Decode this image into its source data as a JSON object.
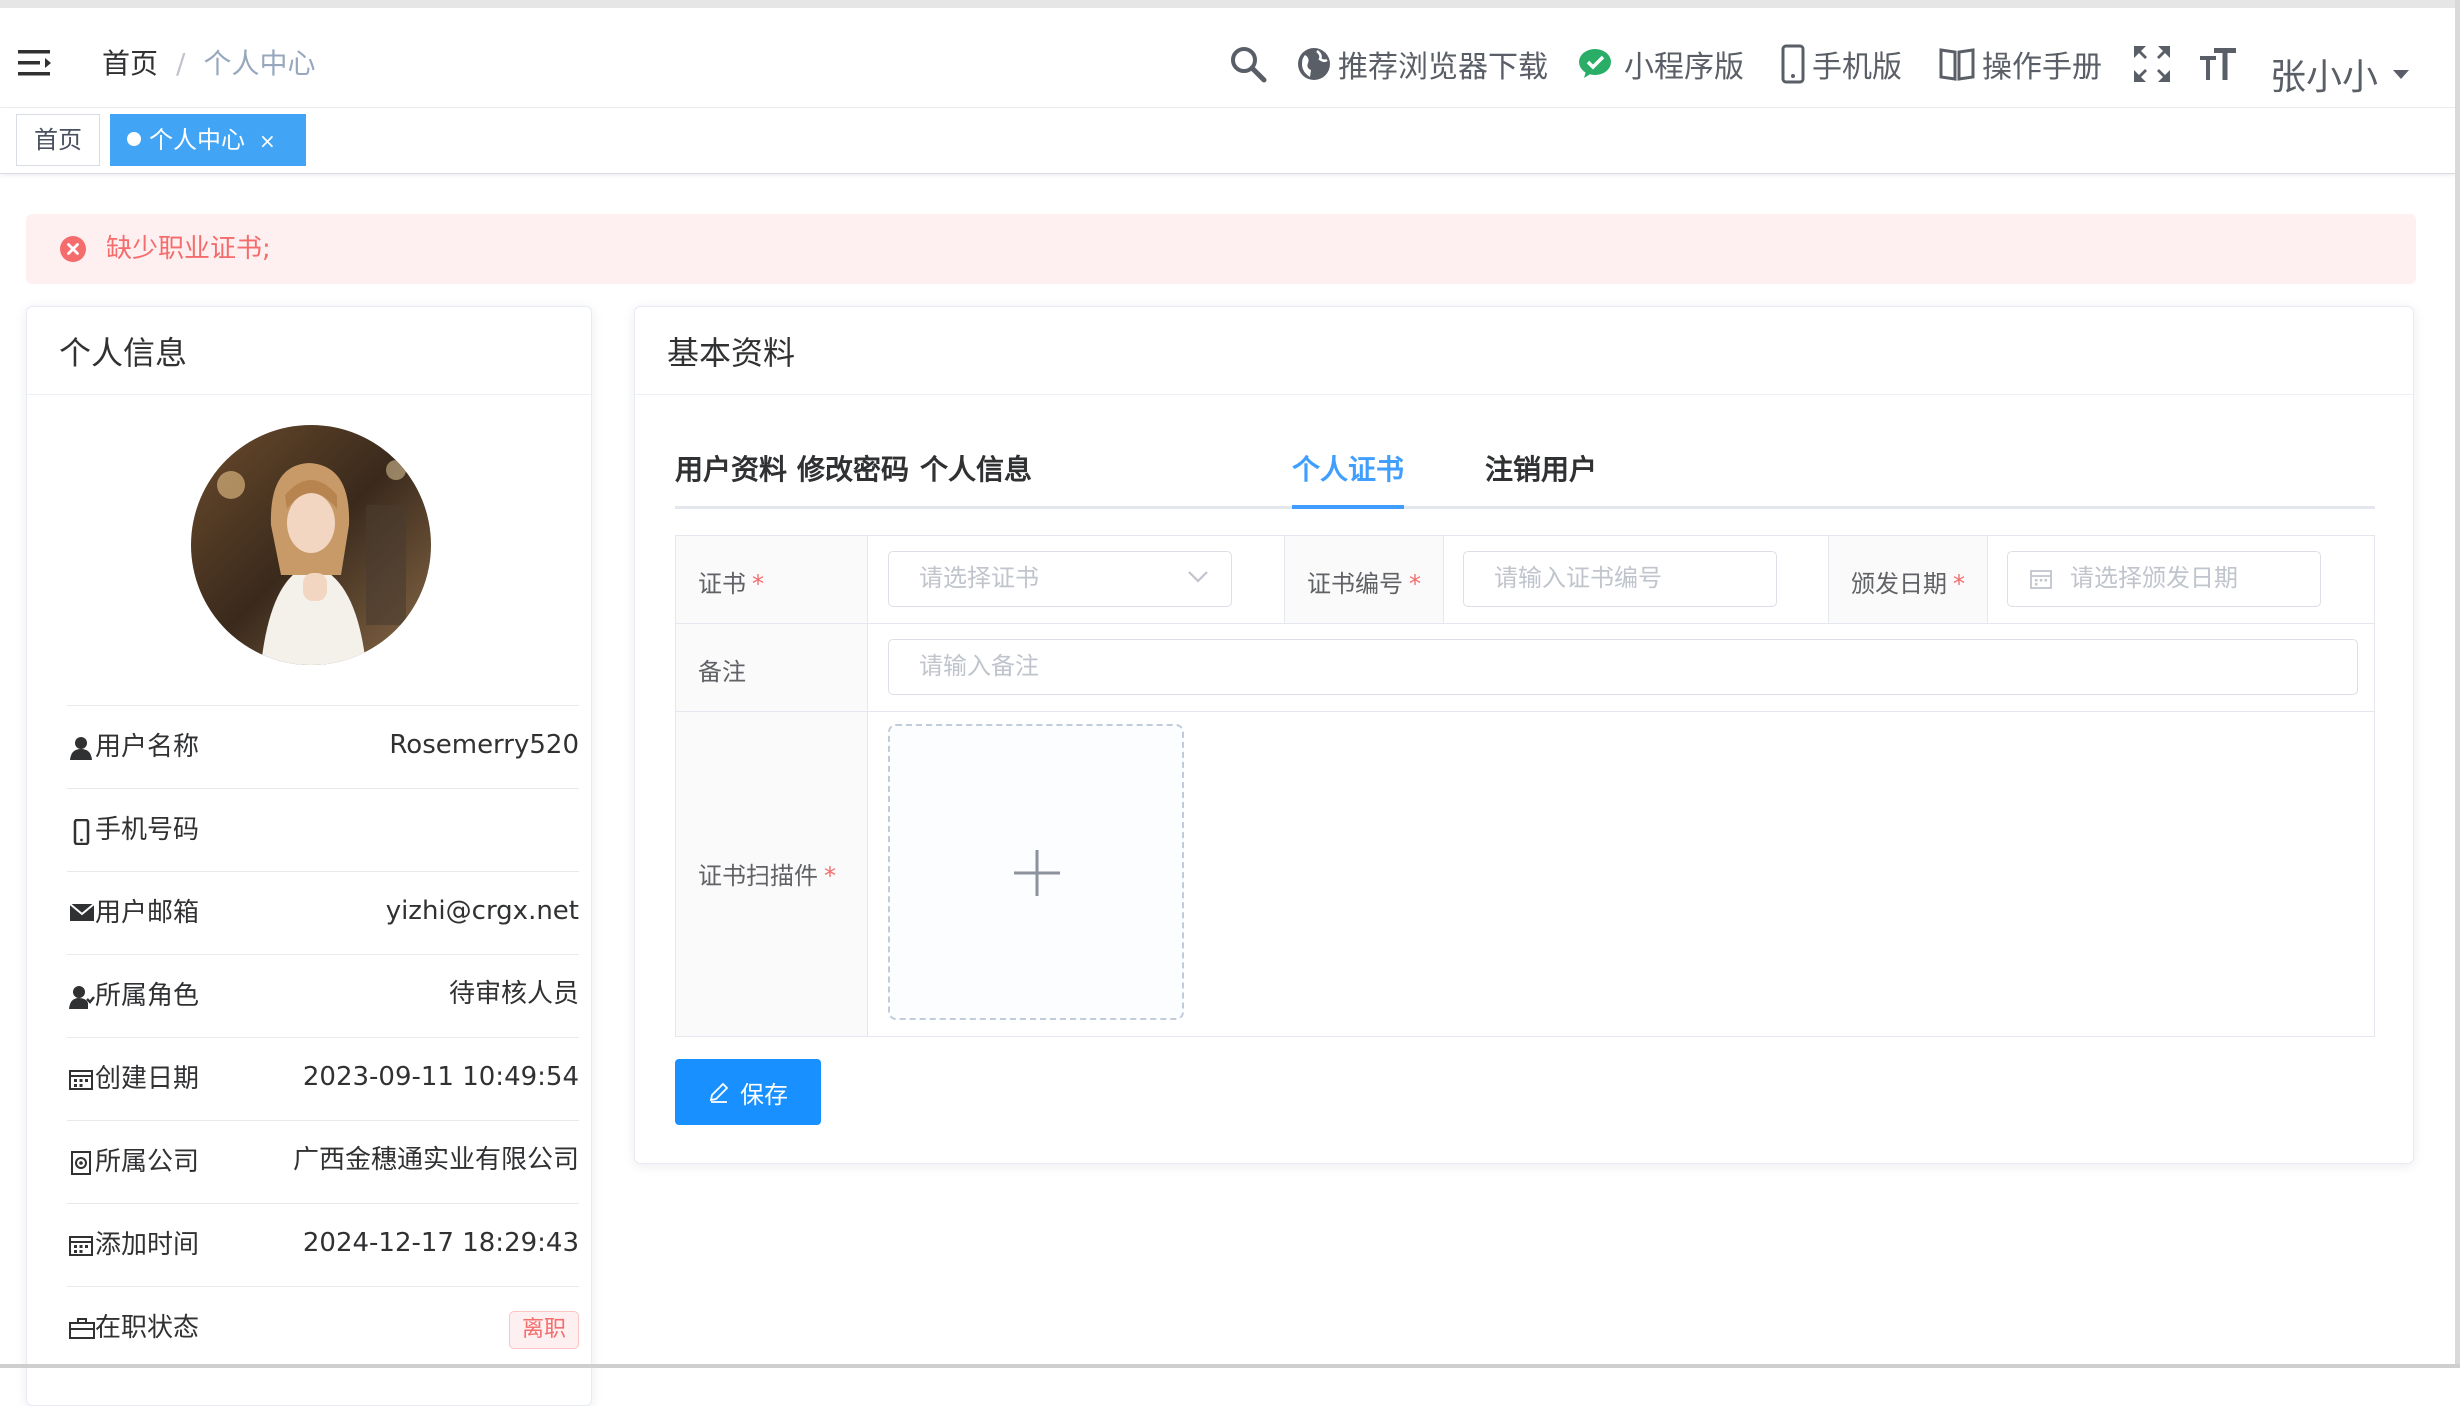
{
  "header": {
    "breadcrumb": {
      "home": "首页",
      "separator": "/",
      "current": "个人中心"
    },
    "tools": {
      "browser_download": "推荐浏览器下载",
      "mini_program": "小程序版",
      "mobile": "手机版",
      "manual": "操作手册"
    },
    "username": "张小小"
  },
  "tags": {
    "home": "首页",
    "current": "个人中心",
    "close": "×"
  },
  "alert": {
    "message": "缺少职业证书;"
  },
  "profile_card": {
    "title": "个人信息",
    "rows": [
      {
        "label": "用户名称",
        "value": "Rosemerry520",
        "icon": "user-icon"
      },
      {
        "label": "手机号码",
        "value": "",
        "icon": "phone-icon"
      },
      {
        "label": "用户邮箱",
        "value": "yizhi@crgx.net",
        "icon": "mail-icon"
      },
      {
        "label": "所属角色",
        "value": "待审核人员",
        "icon": "role-icon"
      },
      {
        "label": "创建日期",
        "value": "2023-09-11 10:49:54",
        "icon": "calendar-icon"
      },
      {
        "label": "所属公司",
        "value": "广西金穗通实业有限公司",
        "icon": "company-icon"
      },
      {
        "label": "添加时间",
        "value": "2024-12-17 18:29:43",
        "icon": "calendar-icon"
      },
      {
        "label": "在职状态",
        "value": "离职",
        "icon": "briefcase-icon"
      }
    ]
  },
  "basic_card": {
    "title": "基本资料",
    "tabs": [
      "用户资料",
      "修改密码",
      "个人信息",
      "个人证书",
      "注销用户"
    ],
    "active_tab": "个人证书",
    "form": {
      "certificate_label": "证书",
      "certificate_placeholder": "请选择证书",
      "cert_number_label": "证书编号",
      "cert_number_placeholder": "请输入证书编号",
      "issue_date_label": "颁发日期",
      "issue_date_placeholder": "请选择颁发日期",
      "remark_label": "备注",
      "remark_placeholder": "请输入备注",
      "scan_label": "证书扫描件",
      "required_mark": "*"
    },
    "save_label": "保存"
  },
  "colors": {
    "primary": "#409eff",
    "save_button": "#1890ff",
    "danger": "#f56c6c",
    "alert_bg": "#fef0f0",
    "active_tag": "#42a4f5"
  }
}
